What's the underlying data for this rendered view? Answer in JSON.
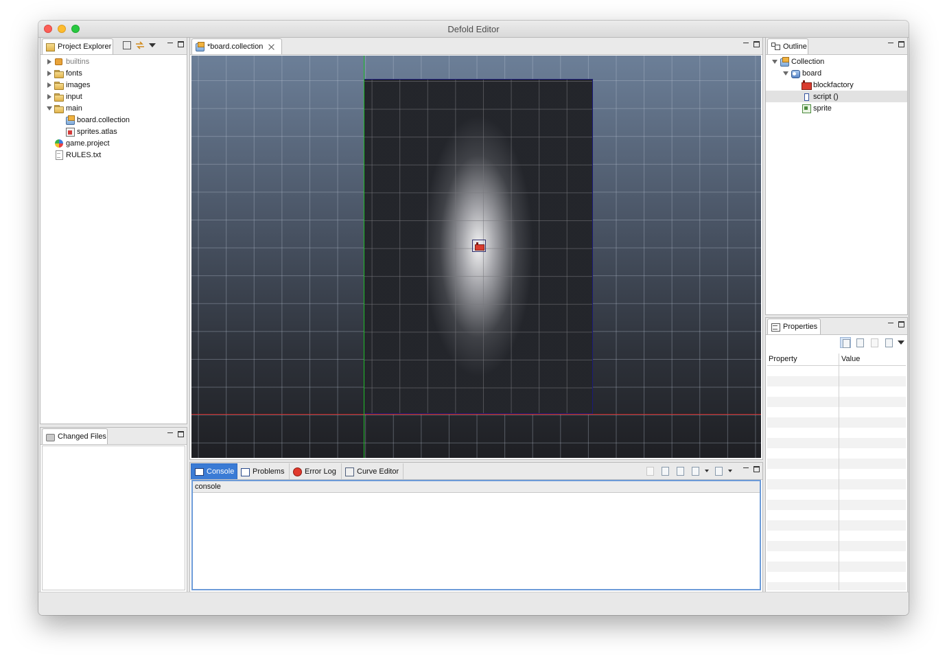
{
  "window": {
    "title": "Defold Editor"
  },
  "project_explorer": {
    "tab_label": "Project Explorer",
    "items": [
      {
        "label": "builtins",
        "expand": "right",
        "icon": "puzzle-icon",
        "depth": 0,
        "dim": true
      },
      {
        "label": "fonts",
        "expand": "right",
        "icon": "folder-icon",
        "depth": 0
      },
      {
        "label": "images",
        "expand": "right",
        "icon": "folder-icon",
        "depth": 0
      },
      {
        "label": "input",
        "expand": "right",
        "icon": "folder-icon",
        "depth": 0
      },
      {
        "label": "main",
        "expand": "down",
        "icon": "folder-open-icon",
        "depth": 0
      },
      {
        "label": "board.collection",
        "expand": "none",
        "icon": "collection-icon",
        "depth": 1
      },
      {
        "label": "sprites.atlas",
        "expand": "none",
        "icon": "atlas-icon",
        "depth": 1
      },
      {
        "label": "game.project",
        "expand": "none",
        "icon": "project-icon",
        "depth": 0
      },
      {
        "label": "RULES.txt",
        "expand": "none",
        "icon": "text-file-icon",
        "depth": 0
      }
    ]
  },
  "changed_files": {
    "tab_label": "Changed Files"
  },
  "editor": {
    "tab_label": "*board.collection"
  },
  "outline": {
    "tab_label": "Outline",
    "items": [
      {
        "label": "Collection",
        "expand": "down",
        "icon": "collection-icon",
        "depth": 0
      },
      {
        "label": "board",
        "expand": "down",
        "icon": "game-object-icon",
        "depth": 1
      },
      {
        "label": "blockfactory",
        "expand": "none",
        "icon": "factory-icon",
        "depth": 2
      },
      {
        "label": "script ()",
        "expand": "none",
        "icon": "script-icon",
        "depth": 2,
        "selected": true
      },
      {
        "label": "sprite",
        "expand": "none",
        "icon": "sprite-icon",
        "depth": 2
      }
    ]
  },
  "properties": {
    "tab_label": "Properties",
    "columns": [
      "Property",
      "Value"
    ]
  },
  "bottom_panel": {
    "tabs": [
      {
        "label": "Console",
        "icon": "console-icon",
        "active": true
      },
      {
        "label": "Problems",
        "icon": "problems-icon"
      },
      {
        "label": "Error Log",
        "icon": "error-log-icon"
      },
      {
        "label": "Curve Editor",
        "icon": "curve-editor-icon"
      }
    ],
    "console_label": "console"
  },
  "colors": {
    "accent_blue": "#3a7bd5",
    "x_axis": "#c82020",
    "y_axis": "#1fbf2a"
  }
}
